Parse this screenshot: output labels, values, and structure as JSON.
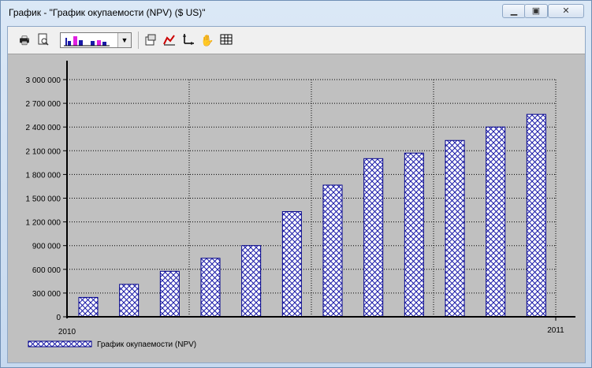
{
  "window": {
    "title": "График - \"График окупаемости (NPV) ($ US)\"",
    "minimize_icon": "minimize-icon",
    "maximize_icon": "maximize-icon",
    "close_icon": "close-icon"
  },
  "toolbar": {
    "icons": [
      "print-icon",
      "print-preview-icon",
      "chart-type-combo",
      "chart-properties-icon",
      "series-icon",
      "axes-icon",
      "hand-icon",
      "table-icon"
    ]
  },
  "chart_data": {
    "type": "bar",
    "title": "",
    "xlabel": "",
    "ylabel": "",
    "x_tick_labels": [
      "2010",
      "2011"
    ],
    "y_ticks": [
      "0",
      "300 000",
      "600 000",
      "900 000",
      "1 200 000",
      "1 500 000",
      "1 800 000",
      "2 100 000",
      "2 400 000",
      "2 700 000",
      "3 000 000"
    ],
    "ylim": [
      0,
      3000000
    ],
    "series": [
      {
        "name": "График окупаемости (NPV)",
        "values": [
          245000,
          410000,
          575000,
          740000,
          900000,
          1330000,
          1665000,
          2000000,
          2070000,
          2230000,
          2400000,
          2560000
        ]
      }
    ],
    "colors": {
      "bar_fill": "#ffffff",
      "bar_hatch": "#1a1aa8",
      "bar_border": "#00008b",
      "background": "#c0c0c0",
      "grid": "#000000"
    },
    "grid": true,
    "legend_position": "bottom-left"
  }
}
